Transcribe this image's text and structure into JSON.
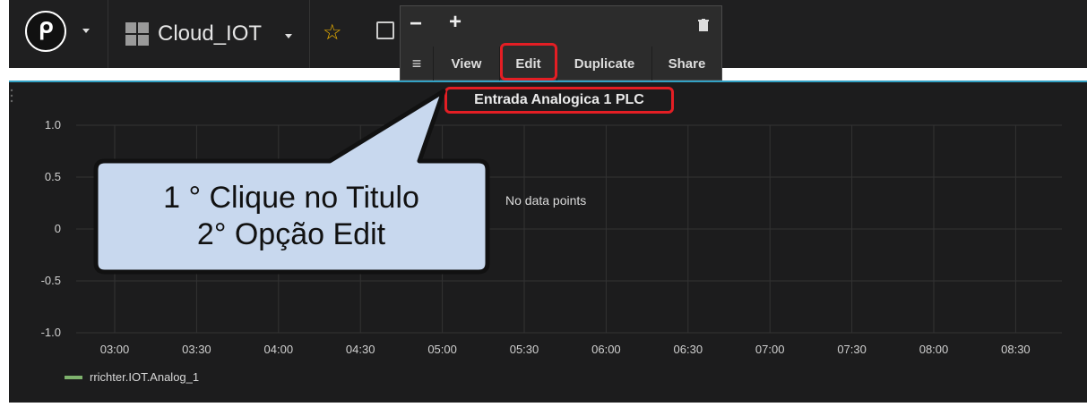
{
  "topbar": {
    "dashboard_name": "Cloud_IOT",
    "logo_icon": "grafana-logo-icon",
    "star_icon": "star-icon",
    "share_icon": "share-icon"
  },
  "panel_menu": {
    "zoom_out": "−",
    "zoom_in": "+",
    "trash_icon": "trash-icon",
    "menu_icon": "≡",
    "items": [
      "View",
      "Edit",
      "Duplicate",
      "Share"
    ]
  },
  "panel": {
    "title": "Entrada Analogica 1 PLC",
    "no_data": "No data points",
    "legend_series": "rrichter.IOT.Analog_1"
  },
  "chart_data": {
    "type": "line",
    "y_ticks": [
      "1.0",
      "0.5",
      "0",
      "-0.5",
      "-1.0"
    ],
    "x_ticks": [
      "03:00",
      "03:30",
      "04:00",
      "04:30",
      "05:00",
      "05:30",
      "06:00",
      "06:30",
      "07:00",
      "07:30",
      "08:00",
      "08:30"
    ],
    "ylim": [
      -1.0,
      1.0
    ],
    "series": [
      {
        "name": "rrichter.IOT.Analog_1",
        "values": []
      }
    ],
    "grid": true
  },
  "callout": {
    "line1": "1 ° Clique no Titulo",
    "line2": "2° Opção Edit"
  },
  "colors": {
    "highlight": "#e31e24",
    "panel_border": "#33a2c5",
    "series": "#7eb26d",
    "callout_fill": "#c8d8ee"
  }
}
